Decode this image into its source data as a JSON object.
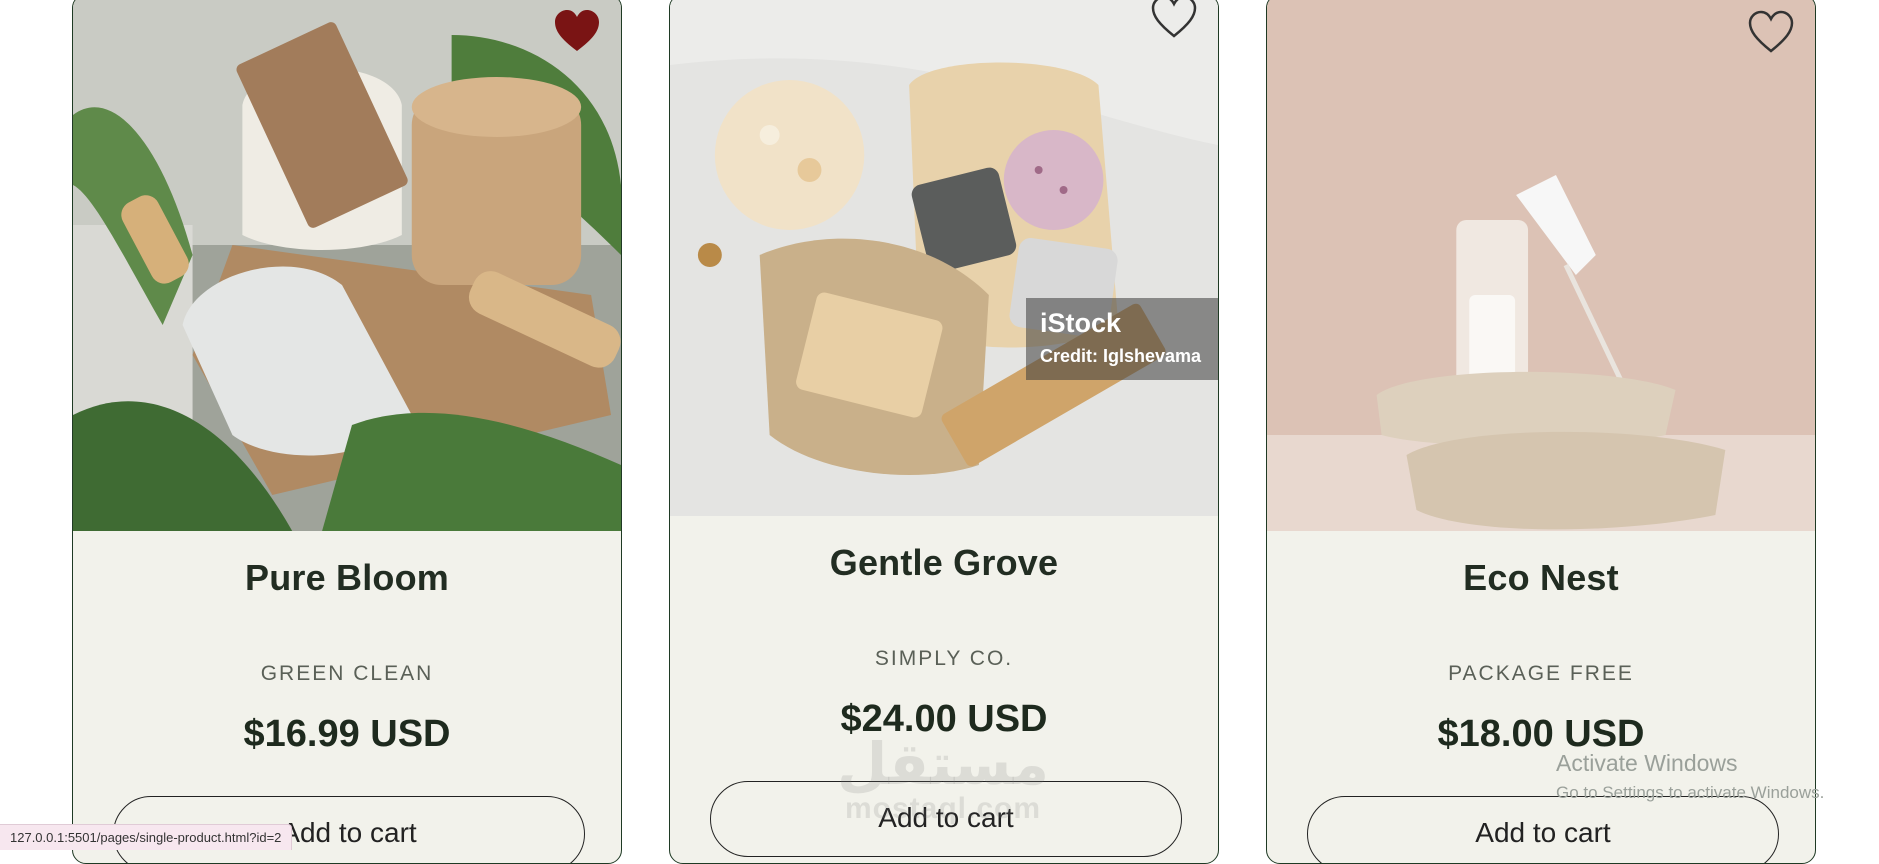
{
  "products": [
    {
      "name": "Pure Bloom",
      "brand": "GREEN CLEAN",
      "price": "$16.99 USD",
      "cart_label": "Add to cart",
      "favorited": true
    },
    {
      "name": "Gentle Grove",
      "brand": "SIMPLY CO.",
      "price": "$24.00 USD",
      "cart_label": "Add to cart",
      "favorited": false
    },
    {
      "name": "Eco Nest",
      "brand": "PACKAGE FREE",
      "price": "$18.00 USD",
      "cart_label": "Add to cart",
      "favorited": false
    }
  ],
  "image_overlay": {
    "logo": "iStock",
    "credit": "Credit: Iglshevama"
  },
  "watermark": {
    "arabic": "مستقل",
    "latin": "mostaql.com"
  },
  "os_notice": {
    "title": "Activate Windows",
    "subtitle": "Go to Settings to activate Windows."
  },
  "status_bar": {
    "url": "127.0.0.1:5501/pages/single-product.html?id=2"
  },
  "colors": {
    "heart_active": "#7a1414",
    "card_bg": "#f2f2eb",
    "border": "#1f3a24"
  }
}
